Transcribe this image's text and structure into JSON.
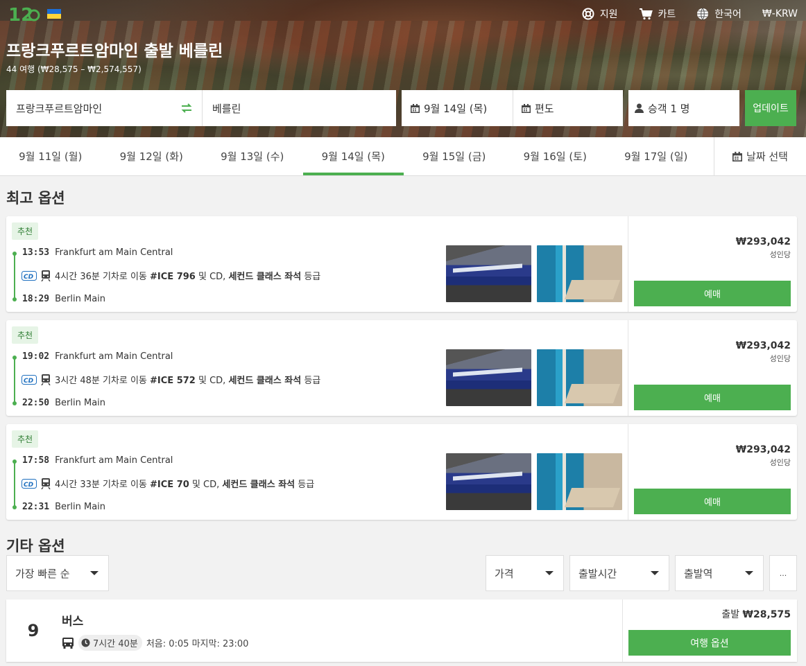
{
  "header": {
    "logo_text": "12Go",
    "nav": [
      {
        "label": "지원",
        "icon": "lifebuoy-icon"
      },
      {
        "label": "카트",
        "icon": "cart-icon"
      },
      {
        "label": "한국어",
        "icon": "globe-icon"
      },
      {
        "label": "₩-KRW",
        "icon": ""
      }
    ],
    "title": "프랑크푸르트암마인 출발 베를린",
    "subtitle": "44 여행 (₩28,575 – ₩2,574,557)"
  },
  "search": {
    "from": "프랑크푸르트암마인",
    "to": "베를린",
    "date": "9월 14일 (목)",
    "return": "편도",
    "passengers": "승객 1 명",
    "update_label": "업데이트"
  },
  "dates": {
    "tabs": [
      "9월 11일 (월)",
      "9월 12일 (화)",
      "9월 13일 (수)",
      "9월 14일 (목)",
      "9월 15일 (금)",
      "9월 16일 (토)",
      "9월 17일 (일)"
    ],
    "active_index": 3,
    "pick_label": "날짜 선택"
  },
  "best": {
    "title": "최고 옵션",
    "cards": [
      {
        "badge": "추천",
        "dep_time": "13:53",
        "dep_station": "Frankfurt am Main Central",
        "duration_text": "4시간 36분 기차로 이동",
        "train": "#ICE 796",
        "operator_text": "및 CD,",
        "class": "세컨드 클래스 좌석",
        "class_suffix": "등급",
        "arr_time": "18:29",
        "arr_station": "Berlin Main",
        "price": "₩293,042",
        "per": "성인당",
        "book": "예매"
      },
      {
        "badge": "추천",
        "dep_time": "19:02",
        "dep_station": "Frankfurt am Main Central",
        "duration_text": "3시간 48분 기차로 이동",
        "train": "#ICE 572",
        "operator_text": "및 CD,",
        "class": "세컨드 클래스 좌석",
        "class_suffix": "등급",
        "arr_time": "22:50",
        "arr_station": "Berlin Main",
        "price": "₩293,042",
        "per": "성인당",
        "book": "예매"
      },
      {
        "badge": "추천",
        "dep_time": "17:58",
        "dep_station": "Frankfurt am Main Central",
        "duration_text": "4시간 33분 기차로 이동",
        "train": "#ICE 70",
        "operator_text": "및 CD,",
        "class": "세컨드 클래스 좌석",
        "class_suffix": "등급",
        "arr_time": "22:31",
        "arr_station": "Berlin Main",
        "price": "₩293,042",
        "per": "성인당",
        "book": "예매"
      }
    ]
  },
  "other": {
    "title": "기타 옵션",
    "sort": "가장 빠른 순",
    "filters": [
      "가격",
      "출발시간",
      "출발역"
    ],
    "more": "...",
    "bus": {
      "count": "9",
      "name": "버스",
      "duration": "7시간 40분",
      "first_last": "처음: 0:05 마지막: 23:00",
      "from_label": "출발",
      "price": "₩28,575",
      "button": "여행 옵션"
    }
  },
  "colors": {
    "accent": "#4caf50",
    "badge_bg": "#e6f4e6"
  }
}
